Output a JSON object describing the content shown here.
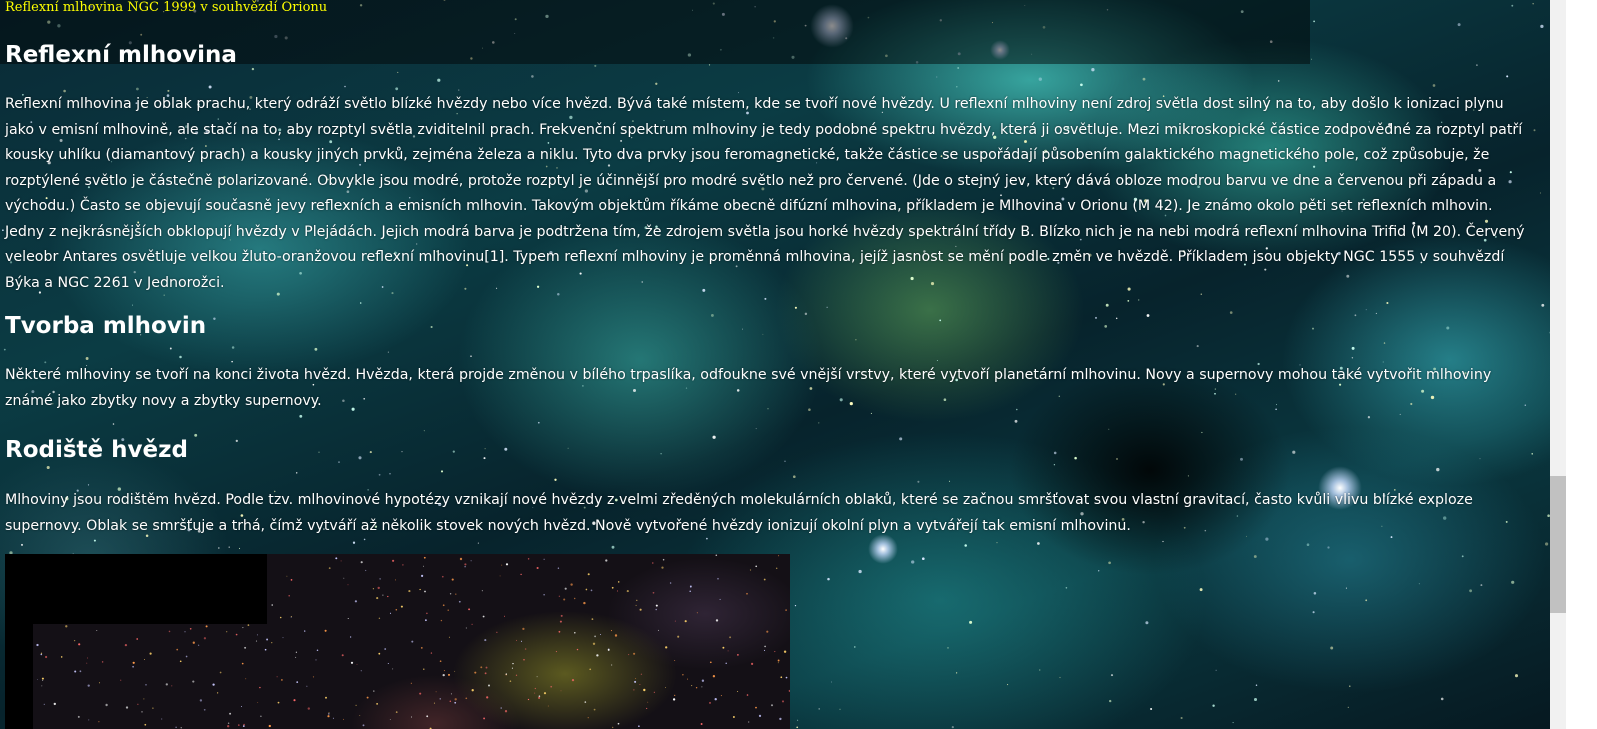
{
  "caption": "Reflexní mlhovina NGC 1999 v souhvězdí Orionu",
  "sections": [
    {
      "heading": "Reflexní mlhovina",
      "text": "Reflexní mlhovina je oblak prachu, který odráží světlo blízké hvězdy nebo více hvězd. Bývá také místem, kde se tvoří nové hvězdy. U reflexní mlhoviny není zdroj světla dost silný na to, aby došlo k ionizaci plynu jako v emisní mlhovině, ale stačí na to, aby rozptyl světla zviditelnil prach. Frekvenční spektrum mlhoviny je tedy podobné spektru hvězdy, která ji osvětluje. Mezi mikroskopické částice zodpovědné za rozptyl patří kousky uhlíku (diamantový prach) a kousky jiných prvků, zejména železa a niklu. Tyto dva prvky jsou feromagnetické, takže částice se uspořádají působením galaktického magnetického pole, což způsobuje, že rozptýlené světlo je částečně polarizované. Obvykle jsou modré, protože rozptyl je účinnější pro modré světlo než pro červené. (Jde o stejný jev, který dává obloze modrou barvu ve dne a červenou při západu a východu.) Často se objevují současně jevy reflexních a emisních mlhovin. Takovým objektům říkáme obecně difúzní mlhovina, příkladem je Mlhovina v Orionu (M 42). Je známo okolo pěti set reflexních mlhovin. Jedny z nejkrásnějších obklopují hvězdy v Plejádách. Jejich modrá barva je podtržena tím, že zdrojem světla jsou horké hvězdy spektrální třídy B. Blízko nich je na nebi modrá reflexní mlhovina Trifid (M 20). Červený veleobr Antares osvětluje velkou žluto-oranžovou reflexní mlhovinu[1]. Typem reflexní mlhoviny je proměnná mlhovina, jejíž jasnost se mění podle změn ve hvězdě. Příkladem jsou objekty NGC 1555 v souhvězdí Býka a NGC 2261 v Jednorožci."
    },
    {
      "heading": "Tvorba mlhovin",
      "text": "Některé mlhoviny se tvoří na konci života hvězd. Hvězda, která projde změnou v bílého trpaslíka, odfoukne své vnější vrstvy, které vytvoří planetární mlhovinu. Novy a supernovy mohou také vytvořit mlhoviny známé jako zbytky novy a zbytky supernovy."
    },
    {
      "heading": "Rodiště hvězd",
      "text": "Mlhoviny jsou rodištěm hvězd. Podle tzv. mlhovinové hypotézy vznikají nové hvězdy z velmi zředěných molekulárních oblaků, které se začnou smršťovat svou vlastní gravitací, často kvůli vlivu blízké exploze supernovy. Oblak se smršťuje a trhá, čímž vytváří až několik stovek nových hvězd. Nově vytvořené hvězdy ionizují okolní plyn a vytvářejí tak emisní mlhovinu."
    }
  ],
  "colors": {
    "caption": "#ffff00",
    "text": "#ffffff",
    "scrollbar_thumb": "#c1c1c1",
    "scrollbar_track": "#f1f1f1"
  },
  "icons": [
    "nebula-background-image",
    "nebula-photo"
  ]
}
